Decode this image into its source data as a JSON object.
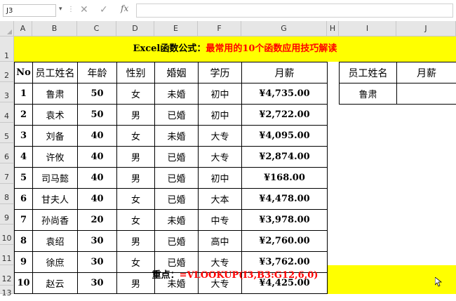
{
  "formula_bar": {
    "name_box": "J3",
    "fx": "fx",
    "cancel_icon": "✕",
    "enter_icon": "✓",
    "formula": ""
  },
  "columns": [
    "A",
    "B",
    "C",
    "D",
    "E",
    "F",
    "G",
    "H",
    "I",
    "J"
  ],
  "rows": [
    "1",
    "2",
    "3",
    "4",
    "5",
    "6",
    "7",
    "8",
    "9",
    "10",
    "11",
    "12",
    "13"
  ],
  "title": {
    "prefix": "Excel函数公式：",
    "highlight": "最常用的10个函数应用技巧解读"
  },
  "table": {
    "headers": [
      "No",
      "员工姓名",
      "年龄",
      "性别",
      "婚姻",
      "学历",
      "月薪"
    ],
    "rows": [
      [
        "1",
        "鲁肃",
        "50",
        "女",
        "未婚",
        "初中",
        "¥4,735.00"
      ],
      [
        "2",
        "袁术",
        "50",
        "男",
        "已婚",
        "初中",
        "¥2,722.00"
      ],
      [
        "3",
        "刘备",
        "40",
        "女",
        "未婚",
        "大专",
        "¥4,095.00"
      ],
      [
        "4",
        "许攸",
        "40",
        "男",
        "已婚",
        "大专",
        "¥2,874.00"
      ],
      [
        "5",
        "司马懿",
        "40",
        "男",
        "已婚",
        "初中",
        "¥168.00"
      ],
      [
        "6",
        "甘夫人",
        "40",
        "女",
        "已婚",
        "大本",
        "¥4,478.00"
      ],
      [
        "7",
        "孙尚香",
        "20",
        "女",
        "未婚",
        "中专",
        "¥3,978.00"
      ],
      [
        "8",
        "袁绍",
        "30",
        "男",
        "已婚",
        "高中",
        "¥2,760.00"
      ],
      [
        "9",
        "徐庶",
        "30",
        "女",
        "已婚",
        "大专",
        "¥3,762.00"
      ],
      [
        "10",
        "赵云",
        "30",
        "男",
        "未婚",
        "大专",
        "¥4,425.00"
      ]
    ]
  },
  "lookup": {
    "headers": [
      "员工姓名",
      "月薪"
    ],
    "name": "鲁肃",
    "result": ""
  },
  "hint": {
    "label": "重点：",
    "formula": "=VLOOKUP(I3,B3:G12,6,0)"
  },
  "colors": {
    "band": "#ffff00",
    "highlight": "#ff0000"
  }
}
